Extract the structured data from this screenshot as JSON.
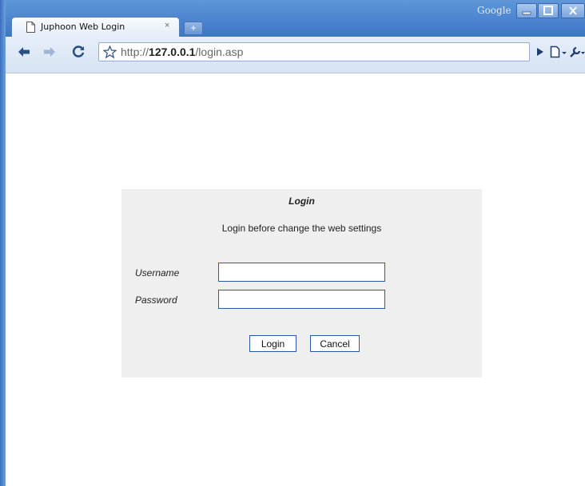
{
  "browser": {
    "tab_title": "Juphoon Web Login",
    "tab_close": "×",
    "new_tab": "+",
    "google_label": "Google",
    "url_prefix": "http://",
    "url_host": "127.0.0.1",
    "url_path": "/login.asp",
    "window_controls": [
      "minimize",
      "maximize",
      "close"
    ]
  },
  "login": {
    "title": "Login",
    "subtitle": "Login before change the web settings",
    "username_label": "Username",
    "username_value": "",
    "password_label": "Password",
    "password_value": "",
    "login_button": "Login",
    "cancel_button": "Cancel"
  }
}
